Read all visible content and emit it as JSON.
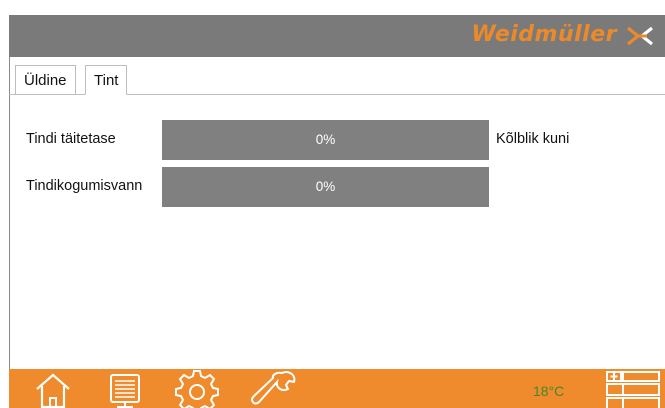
{
  "header": {
    "brand": "Weidmüller",
    "logo_icon": "weidmuller-logo-icon"
  },
  "tabs": [
    {
      "label": "Üldine",
      "active": false
    },
    {
      "label": "Tint",
      "active": true
    }
  ],
  "rows": [
    {
      "label": "Tindi täitetase",
      "value": "0%",
      "fill_fraction": 0,
      "extra": "Kõlblik kuni"
    },
    {
      "label": "Tindikogumisvann",
      "value": "0%",
      "fill_fraction": 0
    }
  ],
  "footer": {
    "buttons": [
      "home-icon",
      "printer-icon",
      "gear-icon",
      "wrench-icon"
    ],
    "temperature": "18°C",
    "menu_icon": "layout-menu-icon"
  },
  "colors": {
    "accent": "#ef8b2c",
    "header_bg": "#7a7a7a",
    "bar_bg": "#808080",
    "temp_text": "#3e8a2a"
  }
}
